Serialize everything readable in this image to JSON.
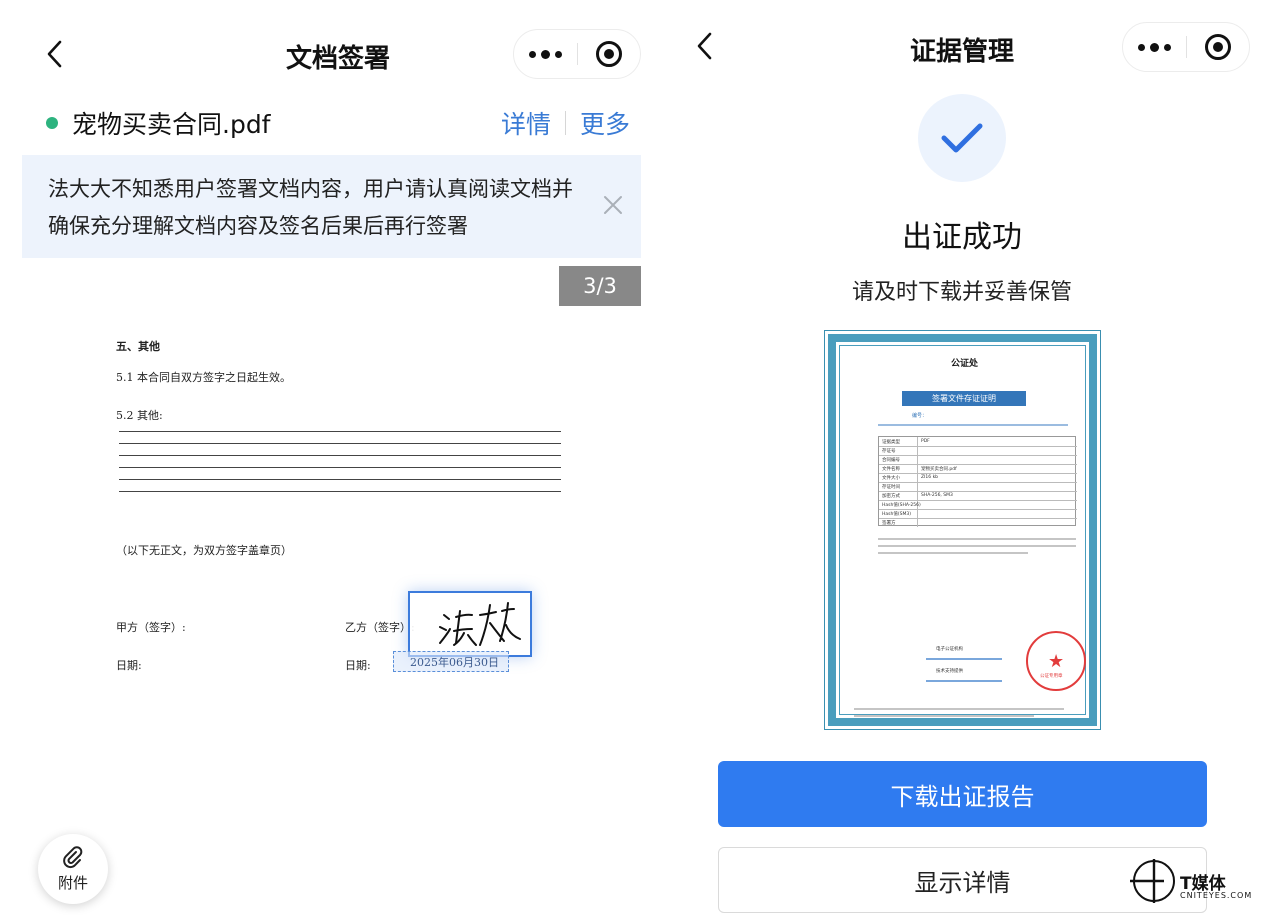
{
  "left": {
    "nav": {
      "title": "文档签署"
    },
    "file": {
      "name": "宠物买卖合同.pdf",
      "details_link": "详情",
      "more_link": "更多",
      "status_color": "#2db37f"
    },
    "notice": {
      "text": "法大大不知悉用户签署文档内容，用户请认真阅读文档并确保充分理解文档内容及签名后果后再行签署"
    },
    "page_indicator": "3/3",
    "document": {
      "section_heading": "五、其他",
      "clause_5_1": "5.1 本合同自双方签字之日起生效。",
      "clause_5_2": "5.2 其他:",
      "end_note": "（以下无正文，为双方签字盖章页）",
      "party_a_label": "甲方（签字）:",
      "party_b_label": "乙方（签字）:",
      "date_label_a": "日期:",
      "date_label_b": "日期:",
      "signature_text": "法大大",
      "sign_date": "2025年06月30日"
    },
    "attachment": {
      "label": "附件"
    }
  },
  "right": {
    "nav": {
      "title": "证据管理"
    },
    "success_title": "出证成功",
    "success_subtitle": "请及时下载并妥善保管",
    "certificate": {
      "office": "公证处",
      "ribbon_title": "签署文件存证证明",
      "number_label": "编号：",
      "table_rows": [
        "证据类型",
        "存证号",
        "合同编号",
        "文件名称",
        "文件大小",
        "存证时间",
        "加密方式",
        "Hash值(SHA-256)",
        "Hash值(SM3)",
        "签署方"
      ],
      "cert_type_value": "PDF",
      "file_size_value": "ZI16 kb",
      "encryption_value": "SHA-256, SM3",
      "file_name_value": "宠物买卖合同.pdf",
      "seal_text": "公证专用章",
      "issuer_label": "电子公证机构",
      "provider_label": "技术支持提供"
    },
    "buttons": {
      "download": "下载出证报告",
      "details": "显示详情"
    },
    "accent_color": "#2f7bf0"
  },
  "watermark": {
    "cn": "T媒体",
    "en": "CNITEYES.COM"
  }
}
